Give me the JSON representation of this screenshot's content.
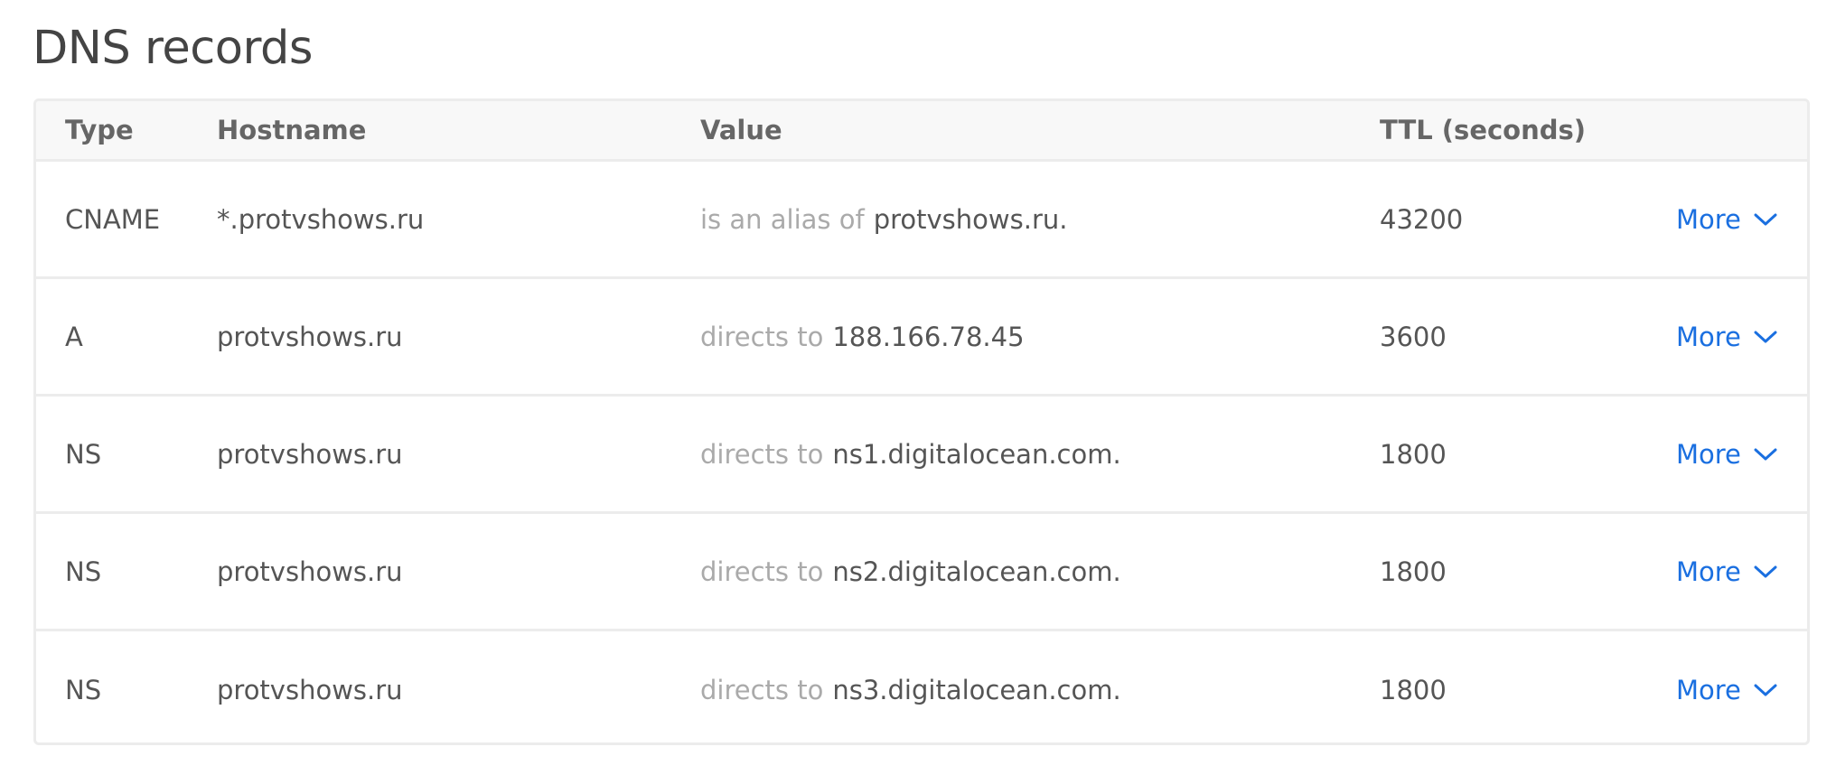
{
  "page": {
    "title": "DNS records"
  },
  "table": {
    "headers": {
      "type": "Type",
      "hostname": "Hostname",
      "value": "Value",
      "ttl": "TTL (seconds)"
    },
    "rows": [
      {
        "type": "CNAME",
        "hostname": "*.protvshows.ru",
        "value_prefix": "is an alias of",
        "value": "protvshows.ru.",
        "ttl": "43200",
        "more_label": "More"
      },
      {
        "type": "A",
        "hostname": "protvshows.ru",
        "value_prefix": "directs to",
        "value": "188.166.78.45",
        "ttl": "3600",
        "more_label": "More"
      },
      {
        "type": "NS",
        "hostname": "protvshows.ru",
        "value_prefix": "directs to",
        "value": "ns1.digitalocean.com.",
        "ttl": "1800",
        "more_label": "More"
      },
      {
        "type": "NS",
        "hostname": "protvshows.ru",
        "value_prefix": "directs to",
        "value": "ns2.digitalocean.com.",
        "ttl": "1800",
        "more_label": "More"
      },
      {
        "type": "NS",
        "hostname": "protvshows.ru",
        "value_prefix": "directs to",
        "value": "ns3.digitalocean.com.",
        "ttl": "1800",
        "more_label": "More"
      }
    ]
  },
  "colors": {
    "link": "#1a6fe0",
    "border": "#ececec",
    "header_bg": "#f8f8f8",
    "muted_text": "#aaaaaa"
  },
  "icons": {
    "more": "chevron-down-icon"
  }
}
